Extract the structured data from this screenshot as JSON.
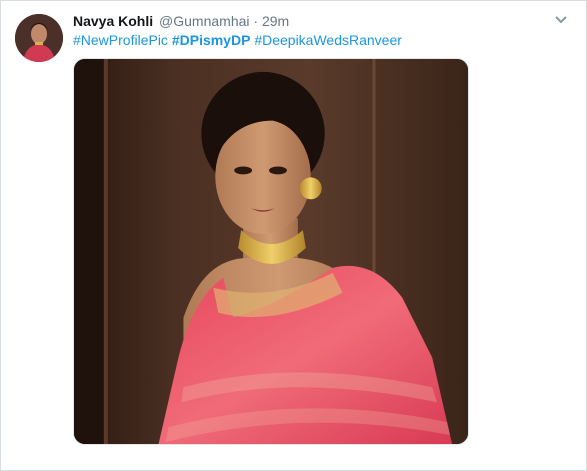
{
  "tweet": {
    "author_name": "Navya Kohli",
    "author_handle": "@Gumnamhai",
    "separator": "·",
    "time": "29m",
    "hashtags": [
      "#NewProfilePic",
      "#DPismyDP",
      "#DeepikaWedsRanveer"
    ],
    "avatar_icon": "profile-photo",
    "menu_icon": "chevron-down-icon",
    "link_color": "#1b95e0",
    "media_description_icon": "photo-woman-red-saree"
  }
}
